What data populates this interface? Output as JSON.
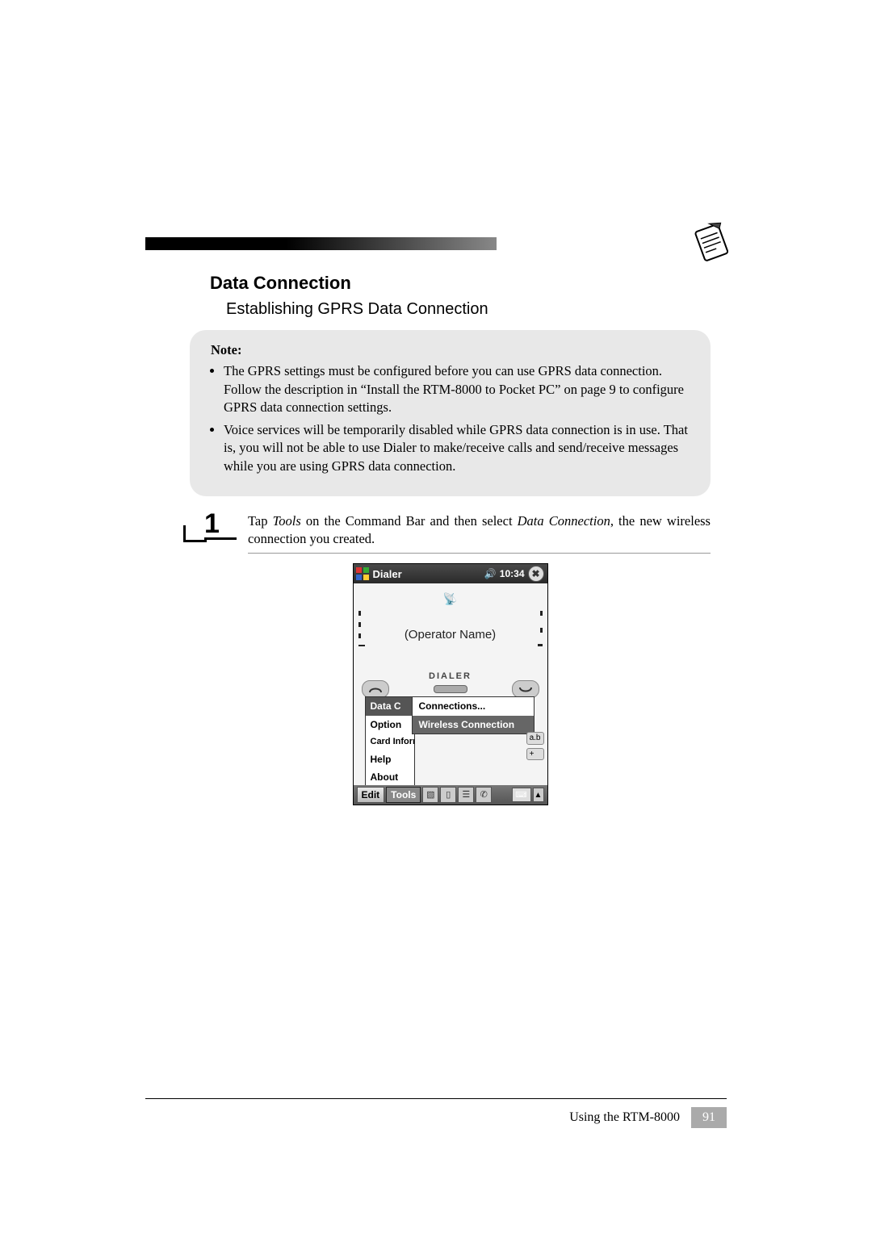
{
  "header": {
    "section_title": "Data Connection",
    "subsection_title": "Establishing GPRS Data Connection"
  },
  "note": {
    "label": "Note:",
    "items": [
      "The GPRS settings must be configured before you can use GPRS data connection. Follow the description in “Install the RTM-8000 to Pocket PC” on page 9 to configure GPRS data connection settings.",
      "Voice services will be temporarily disabled while GPRS data connection is in use. That is, you will not be able to use Dialer to make/receive calls and send/receive messages while you are using GPRS data connection."
    ]
  },
  "step": {
    "number": "1",
    "prefix": "Tap ",
    "italic1": "Tools",
    "mid": " on the Command Bar and then select ",
    "italic2": "Data Connection",
    "suffix": ", the new wireless connection you created."
  },
  "ppc": {
    "title": "Dialer",
    "time": "10:34",
    "operator": "(Operator Name)",
    "dialer_label": "DIALER",
    "menu_left": {
      "data": "Data C",
      "option": "Option",
      "card": "Card Information...",
      "help": "Help",
      "about": "About"
    },
    "submenu": {
      "connections": "Connections...",
      "wireless": "Wireless Connection"
    },
    "cmdbar": {
      "edit": "Edit",
      "tools": "Tools"
    }
  },
  "footer": {
    "text": "Using the RTM-8000",
    "page": "91"
  }
}
